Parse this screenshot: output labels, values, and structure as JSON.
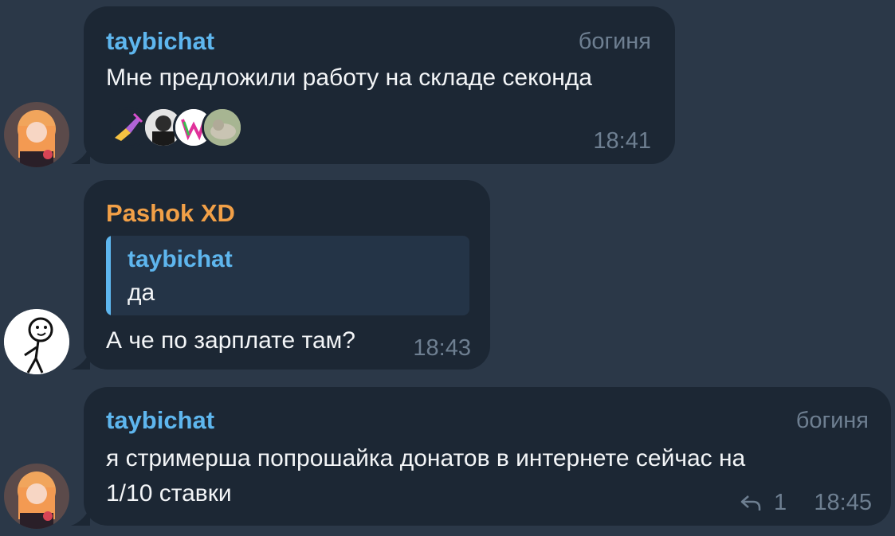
{
  "messages": [
    {
      "sender": "taybichat",
      "role": "богиня",
      "text": "Мне предложили работу на складе секонда",
      "time": "18:41",
      "reactions": [
        "hand-pen-icon",
        "person-photo-icon",
        "w-logo-icon",
        "cat-photo-icon"
      ]
    },
    {
      "sender": "Pashok XD",
      "reply_to": {
        "sender": "taybichat",
        "text": "да"
      },
      "text": "А че по зарплате там?",
      "time": "18:43"
    },
    {
      "sender": "taybichat",
      "role": "богиня",
      "text_line1": "я стримерша попрошайка донатов в интернете сейчас на",
      "text_line2": "1/10 ставки",
      "reply_count": "1",
      "time": "18:45"
    }
  ],
  "colors": {
    "background": "#2b3848",
    "bubble": "#1c2734",
    "sender_blue": "#5eb6ee",
    "sender_orange": "#f2a047",
    "meta_gray": "#6e7f91"
  }
}
